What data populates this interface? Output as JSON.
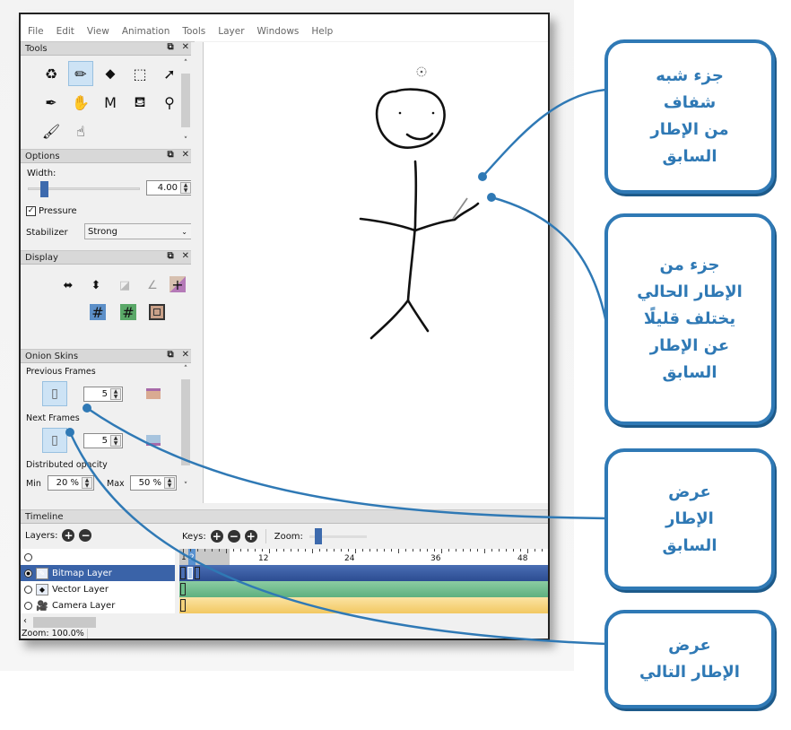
{
  "menu": [
    "File",
    "Edit",
    "View",
    "Animation",
    "Tools",
    "Layer",
    "Windows",
    "Help"
  ],
  "panels": {
    "tools": {
      "title": "Tools",
      "items": [
        {
          "name": "clear-icon",
          "glyph": "♻"
        },
        {
          "name": "pencil-icon",
          "glyph": "✏",
          "selected": true
        },
        {
          "name": "eraser-icon",
          "glyph": "⬥"
        },
        {
          "name": "select-icon",
          "glyph": "⬚"
        },
        {
          "name": "move-icon",
          "glyph": "➚"
        },
        {
          "name": "pen-icon",
          "glyph": "✒"
        },
        {
          "name": "hand-icon",
          "glyph": "✋"
        },
        {
          "name": "polyline-icon",
          "glyph": "M"
        },
        {
          "name": "bucket-icon",
          "glyph": "⛾"
        },
        {
          "name": "eyedropper-icon",
          "glyph": "⚲"
        },
        {
          "name": "brush-icon",
          "glyph": "🖌"
        },
        {
          "name": "smudge-icon",
          "glyph": "☝"
        }
      ]
    },
    "options": {
      "title": "Options",
      "width_label": "Width:",
      "width_value": "4.00",
      "width_slider_fraction": 0.1,
      "pressure_label": "Pressure",
      "pressure_checked": true,
      "stabilizer_label": "Stabilizer",
      "stabilizer_value": "Strong"
    },
    "display": {
      "title": "Display",
      "row1": [
        "flip-horizontal-icon",
        "flip-vertical-icon",
        "overlay-icon",
        "perspective-icon",
        "center-icon"
      ],
      "row2": [
        "grid-blue-icon",
        "grid-green-icon",
        "frame-icon"
      ]
    },
    "onion": {
      "title": "Onion Skins",
      "previous_label": "Previous Frames",
      "previous_count": "5",
      "next_label": "Next Frames",
      "next_count": "5",
      "distributed_label": "Distributed opacity",
      "min_label": "Min",
      "min_value": "20 %",
      "max_label": "Max",
      "max_value": "50 %",
      "previous_color": "#d9aa92",
      "next_color": "#a7c4de"
    }
  },
  "timeline": {
    "title": "Timeline",
    "layers_label": "Layers:",
    "keys_label": "Keys:",
    "zoom_label": "Zoom:",
    "ruler_labels": [
      "1",
      "2",
      "12",
      "24",
      "36",
      "48"
    ],
    "layers": [
      {
        "name": "Bitmap Layer",
        "selected": true,
        "color": "#3a5aa0"
      },
      {
        "name": "Vector Layer",
        "selected": false,
        "color": "#6cbf8a"
      },
      {
        "name": "Camera Layer",
        "selected": false,
        "color": "#f5d27a"
      }
    ],
    "status": "Zoom: 100.0%"
  },
  "callouts": [
    {
      "text": [
        "جزء شبه",
        "شفاف",
        "من الإطار",
        "السابق"
      ]
    },
    {
      "text": [
        "جزء من",
        "الإطار الحالي",
        "يختلف قليلًا",
        "عن الإطار",
        "السابق"
      ]
    },
    {
      "text": [
        "عرض",
        "الإطار",
        "السابق"
      ]
    },
    {
      "text": [
        "عرض",
        "الإطار التالي"
      ]
    }
  ],
  "accent_color": "#2f79b5"
}
